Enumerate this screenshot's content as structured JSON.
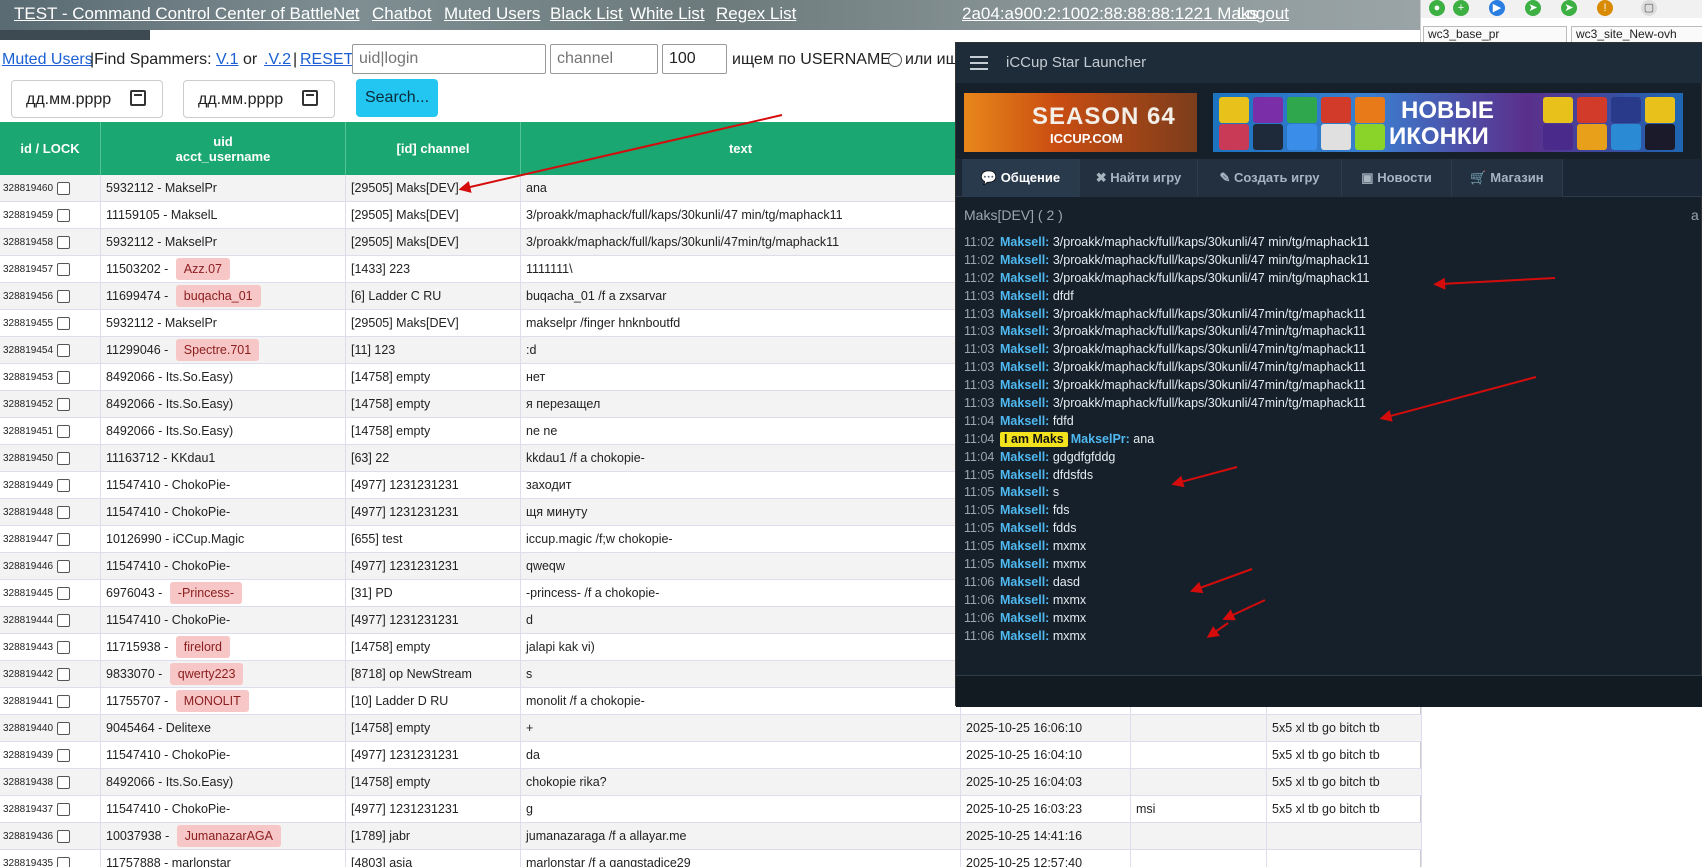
{
  "nav": {
    "title": "TEST - Command Control Center of BattleNet",
    "sep": ":::",
    "chatbot": "Chatbot",
    "muted": "Muted Users",
    "black": "Black List",
    "white": "White List",
    "regex": "Regex List",
    "user": "2a04:a900:2:1002:88:88:88:1221 Maks",
    "logout": "Logout"
  },
  "browser": {
    "tab1": "wc3_base_pr",
    "tab2": "wc3_site_New-ovh"
  },
  "filters": {
    "muted_link": "Muted Users",
    "find_text": "|Find Spammers:",
    "v1": "V.1",
    "or": "or",
    "v2": ".V.2",
    "pipe": "|",
    "reset": "RESET",
    "uid_placeholder": "uid|login",
    "channel_placeholder": "channel",
    "limit_value": "100",
    "search_by": "ищем по USERNAME",
    "or_search": "или ищ",
    "date1": "дд.мм.рррр",
    "date2": "дд.мм.рррр",
    "search_btn": "Search..."
  },
  "table": {
    "headers": {
      "id": "id / LOCK",
      "uid": "uid",
      "acct": "acct_username",
      "channel": "[id] channel",
      "text": "text"
    },
    "rows": [
      {
        "id": "328819460",
        "uid": "5932112 - ",
        "name": "MakselPr",
        "flag": false,
        "ch": "[29505] Maks[DEV]",
        "text": "ana",
        "date": "",
        "extra": "",
        "game": ""
      },
      {
        "id": "328819459",
        "uid": "11159105 - ",
        "name": "MakselL",
        "flag": false,
        "ch": "[29505] Maks[DEV]",
        "text": "3/proakk/maphack/full/kaps/30kunli/47 min/tg/maphack11",
        "date": "",
        "extra": "",
        "game": ""
      },
      {
        "id": "328819458",
        "uid": "5932112 - ",
        "name": "MakselPr",
        "flag": false,
        "ch": "[29505] Maks[DEV]",
        "text": "3/proakk/maphack/full/kaps/30kunli/47min/tg/maphack11",
        "date": "",
        "extra": "",
        "game": ""
      },
      {
        "id": "328819457",
        "uid": "11503202 - ",
        "name": "Azz.07",
        "flag": true,
        "ch": "[1433] 223",
        "text": "1111111\\",
        "date": "",
        "extra": "",
        "game": ""
      },
      {
        "id": "328819456",
        "uid": "11699474 - ",
        "name": "buqacha_01",
        "flag": true,
        "ch": "[6] Ladder C RU",
        "text": "buqacha_01 /f a zxsarvar",
        "date": "",
        "extra": "",
        "game": ""
      },
      {
        "id": "328819455",
        "uid": "5932112 - ",
        "name": "MakselPr",
        "flag": false,
        "ch": "[29505] Maks[DEV]",
        "text": "makselpr /finger hnknboutfd",
        "date": "",
        "extra": "",
        "game": ""
      },
      {
        "id": "328819454",
        "uid": "11299046 - ",
        "name": "Spectre.701",
        "flag": true,
        "ch": "[11] 123",
        "text": ":d",
        "date": "",
        "extra": "",
        "game": ""
      },
      {
        "id": "328819453",
        "uid": "8492066 - ",
        "name": "Its.So.Easy)",
        "flag": false,
        "ch": "[14758] empty",
        "text": "нет",
        "date": "",
        "extra": "",
        "game": ""
      },
      {
        "id": "328819452",
        "uid": "8492066 - ",
        "name": "Its.So.Easy)",
        "flag": false,
        "ch": "[14758] empty",
        "text": "я перезащел",
        "date": "",
        "extra": "",
        "game": ""
      },
      {
        "id": "328819451",
        "uid": "8492066 - ",
        "name": "Its.So.Easy)",
        "flag": false,
        "ch": "[14758] empty",
        "text": "ne ne",
        "date": "",
        "extra": "",
        "game": ""
      },
      {
        "id": "328819450",
        "uid": "11163712 - ",
        "name": "KKdau1",
        "flag": false,
        "ch": "[63] 22",
        "text": "kkdau1 /f a chokopie-",
        "date": "",
        "extra": "",
        "game": ""
      },
      {
        "id": "328819449",
        "uid": "11547410 - ",
        "name": "ChokoPie-",
        "flag": false,
        "ch": "[4977] 1231231231",
        "text": "заходит",
        "date": "",
        "extra": "",
        "game": ""
      },
      {
        "id": "328819448",
        "uid": "11547410 - ",
        "name": "ChokoPie-",
        "flag": false,
        "ch": "[4977] 1231231231",
        "text": "щя минуту",
        "date": "",
        "extra": "",
        "game": ""
      },
      {
        "id": "328819447",
        "uid": "10126990 - ",
        "name": "iCCup.Magic",
        "flag": false,
        "ch": "[655] test",
        "text": "iccup.magic /f;w chokopie-",
        "date": "",
        "extra": "",
        "game": ""
      },
      {
        "id": "328819446",
        "uid": "11547410 - ",
        "name": "ChokoPie-",
        "flag": false,
        "ch": "[4977] 1231231231",
        "text": "qweqw",
        "date": "",
        "extra": "",
        "game": ""
      },
      {
        "id": "328819445",
        "uid": "6976043 - ",
        "name": "-Princess-",
        "flag": true,
        "ch": "[31] PD",
        "text": "-princess- /f a chokopie-",
        "date": "",
        "extra": "",
        "game": ""
      },
      {
        "id": "328819444",
        "uid": "11547410 - ",
        "name": "ChokoPie-",
        "flag": false,
        "ch": "[4977] 1231231231",
        "text": "d",
        "date": "",
        "extra": "",
        "game": ""
      },
      {
        "id": "328819443",
        "uid": "11715938 - ",
        "name": "firelord",
        "flag": true,
        "ch": "[14758] empty",
        "text": "jalapi kak vi)",
        "date": "",
        "extra": "",
        "game": ""
      },
      {
        "id": "328819442",
        "uid": "9833070 - ",
        "name": "qwerty223",
        "flag": true,
        "ch": "[8718] op NewStream",
        "text": "s",
        "date": "",
        "extra": "",
        "game": ""
      },
      {
        "id": "328819441",
        "uid": "11755707 - ",
        "name": "MONOLIT",
        "flag": true,
        "ch": "[10] Ladder D RU",
        "text": "monolit /f a chokopie-",
        "date": "",
        "extra": "",
        "game": ""
      },
      {
        "id": "328819440",
        "uid": "9045464 - ",
        "name": "Delitexe",
        "flag": false,
        "ch": "[14758] empty",
        "text": "+",
        "date": "2025-10-25 16:06:10",
        "extra": "",
        "game": "5x5 xl tb go bitch tb"
      },
      {
        "id": "328819439",
        "uid": "11547410 - ",
        "name": "ChokoPie-",
        "flag": false,
        "ch": "[4977] 1231231231",
        "text": "da",
        "date": "2025-10-25 16:04:10",
        "extra": "",
        "game": "5x5 xl tb go bitch tb"
      },
      {
        "id": "328819438",
        "uid": "8492066 - ",
        "name": "Its.So.Easy)",
        "flag": false,
        "ch": "[14758] empty",
        "text": "chokopie rika?",
        "date": "2025-10-25 16:04:03",
        "extra": "",
        "game": "5x5 xl tb go bitch tb"
      },
      {
        "id": "328819437",
        "uid": "11547410 - ",
        "name": "ChokoPie-",
        "flag": false,
        "ch": "[4977] 1231231231",
        "text": "g",
        "date": "2025-10-25 16:03:23",
        "extra": "msi",
        "game": "5x5 xl tb go bitch tb"
      },
      {
        "id": "328819436",
        "uid": "10037938 - ",
        "name": "JumanazarAGA",
        "flag": true,
        "ch": "[1789] jabr",
        "text": "jumanazaraga /f a allayar.me",
        "date": "2025-10-25 14:41:16",
        "extra": "",
        "game": ""
      },
      {
        "id": "328819435",
        "uid": "11757888 - ",
        "name": "marlonstar",
        "flag": false,
        "ch": "[4803] asia",
        "text": "marlonstar /f a gangstadice29",
        "date": "2025-10-25 12:57:40",
        "extra": "",
        "game": ""
      }
    ]
  },
  "launcher": {
    "title": "iCCup Star Launcher",
    "season": "SEASON 64",
    "site": "ICCUP.COM",
    "new1": "НОВЫЕ",
    "new2": "ИКОНКИ",
    "tabs": [
      "Общение",
      "Найти игру",
      "Создать игру",
      "Новости",
      "Магазин"
    ],
    "room": "Maks[DEV]  ( 2 )",
    "room_right": "a",
    "messages": [
      {
        "t": "11:02",
        "n": "Maksell:",
        "m": " 3/proakk/maphack/full/kaps/30kunli/47  min/tg/maphack11",
        "y": ""
      },
      {
        "t": "11:02",
        "n": "Maksell:",
        "m": " 3/proakk/maphack/full/kaps/30kunli/47  min/tg/maphack11",
        "y": ""
      },
      {
        "t": "11:02",
        "n": "Maksell:",
        "m": " 3/proakk/maphack/full/kaps/30kunli/47  min/tg/maphack11",
        "y": ""
      },
      {
        "t": "11:03",
        "n": "Maksell:",
        "m": " dfdf",
        "y": ""
      },
      {
        "t": "11:03",
        "n": "Maksell:",
        "m": " 3/proakk/maphack/full/kaps/30kunli/47min/tg/maphack11",
        "y": ""
      },
      {
        "t": "11:03",
        "n": "Maksell:",
        "m": " 3/proakk/maphack/full/kaps/30kunli/47min/tg/maphack11",
        "y": ""
      },
      {
        "t": "11:03",
        "n": "Maksell:",
        "m": " 3/proakk/maphack/full/kaps/30kunli/47min/tg/maphack11",
        "y": ""
      },
      {
        "t": "11:03",
        "n": "Maksell:",
        "m": " 3/proakk/maphack/full/kaps/30kunli/47min/tg/maphack11",
        "y": ""
      },
      {
        "t": "11:03",
        "n": "Maksell:",
        "m": " 3/proakk/maphack/full/kaps/30kunli/47min/tg/maphack11",
        "y": ""
      },
      {
        "t": "11:03",
        "n": "Maksell:",
        "m": " 3/proakk/maphack/full/kaps/30kunli/47min/tg/maphack11",
        "y": ""
      },
      {
        "t": "11:04",
        "n": "Maksell:",
        "m": " fdfd",
        "y": ""
      },
      {
        "t": "11:04",
        "n": "MakselPr:",
        "m": " ana",
        "y": "I am Maks"
      },
      {
        "t": "11:04",
        "n": "Maksell:",
        "m": " gdgdfgfddg",
        "y": ""
      },
      {
        "t": "11:05",
        "n": "Maksell:",
        "m": " dfdsfds",
        "y": ""
      },
      {
        "t": "11:05",
        "n": "Maksell:",
        "m": " s",
        "y": ""
      },
      {
        "t": "11:05",
        "n": "Maksell:",
        "m": " fds",
        "y": ""
      },
      {
        "t": "11:05",
        "n": "Maksell:",
        "m": " fdds",
        "y": ""
      },
      {
        "t": "11:05",
        "n": "Maksell:",
        "m": " mxmx",
        "y": ""
      },
      {
        "t": "11:05",
        "n": "Maksell:",
        "m": " mxmx",
        "y": ""
      },
      {
        "t": "11:06",
        "n": "Maksell:",
        "m": " dasd",
        "y": ""
      },
      {
        "t": "11:06",
        "n": "Maksell:",
        "m": " mxmx",
        "y": ""
      },
      {
        "t": "11:06",
        "n": "Maksell:",
        "m": " mxmx",
        "y": ""
      },
      {
        "t": "11:06",
        "n": "Maksell:",
        "m": " mxmx",
        "y": ""
      }
    ]
  },
  "colors": {
    "header": "#1aa771",
    "badge": "#f7c6c6",
    "arrow": "#d40c0c",
    "nick": "#4fb8f0"
  }
}
